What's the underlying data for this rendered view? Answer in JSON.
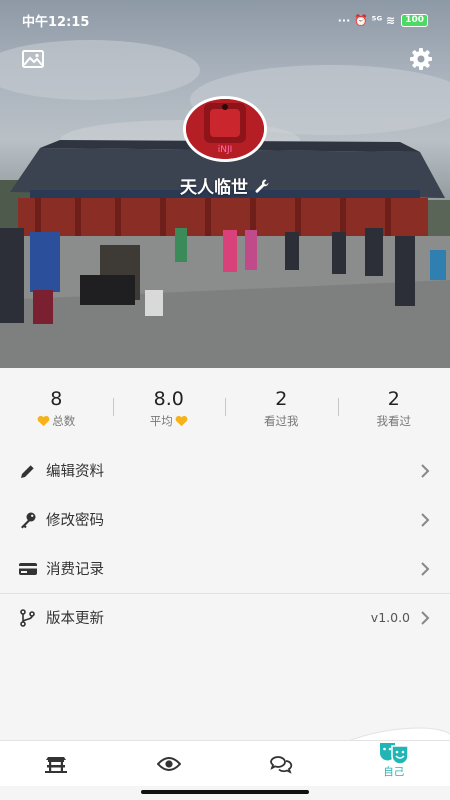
{
  "status_bar": {
    "time": "中午12:15",
    "indicators": "··· ⏰ ⁵ᴳ ≋",
    "battery": "100"
  },
  "header": {
    "left_icon": "image-icon",
    "right_icon": "gear-icon",
    "avatar_text": "iNJI",
    "username": "天人临世",
    "edit_icon": "wrench-icon"
  },
  "stats": [
    {
      "value": "8",
      "label": "总数",
      "heart": "before"
    },
    {
      "value": "8.0",
      "label": "平均",
      "heart": "after"
    },
    {
      "value": "2",
      "label": "看过我",
      "heart": "none"
    },
    {
      "value": "2",
      "label": "我看过",
      "heart": "none"
    }
  ],
  "menu": [
    {
      "icon": "pencil-icon",
      "label": "编辑资料",
      "value": ""
    },
    {
      "icon": "key-icon",
      "label": "修改密码",
      "value": ""
    },
    {
      "icon": "card-icon",
      "label": "消费记录",
      "value": ""
    },
    {
      "icon": "branch-icon",
      "label": "版本更新",
      "value": "v1.0.0"
    }
  ],
  "nav": [
    {
      "icon": "temple-icon",
      "label": ""
    },
    {
      "icon": "eye-icon",
      "label": ""
    },
    {
      "icon": "chat-icon",
      "label": ""
    },
    {
      "icon": "mask-icon",
      "label": "自己"
    }
  ],
  "colors": {
    "accent": "#22b5b5",
    "heart": "#f5b21b",
    "avatar_bg": "#b51e24"
  }
}
